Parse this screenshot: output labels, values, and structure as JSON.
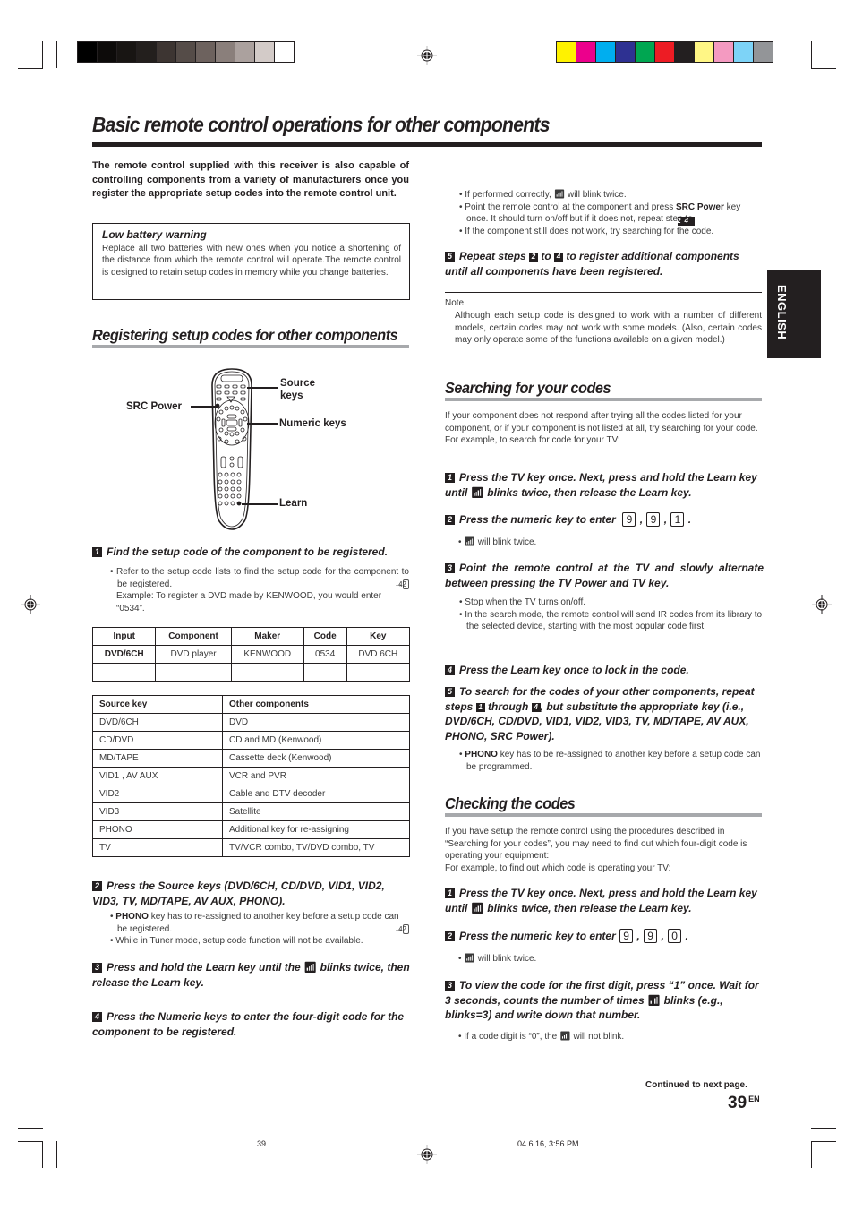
{
  "print_marks": {
    "gray_swatches": [
      "#000000",
      "#0d0b0a",
      "#181513",
      "#231f1d",
      "#3d3532",
      "#554c48",
      "#6d625e",
      "#8a7f7b",
      "#aba19e",
      "#d3cbc8",
      "#ffffff"
    ],
    "color_swatches": [
      "#fff200",
      "#ec008c",
      "#00aeef",
      "#2e3192",
      "#00a651",
      "#ed1c24",
      "#231f20",
      "#fff685",
      "#f49ac1",
      "#7dd3f7",
      "#939598"
    ],
    "footer_page": "39",
    "footer_timestamp": "04.6.16, 3:56 PM"
  },
  "page": {
    "title": "Basic remote control operations for other components",
    "language_tab": "ENGLISH",
    "continued": "Continued to next page.",
    "page_number": "39",
    "page_suffix": "EN"
  },
  "intro": "The remote control supplied with this receiver is also capable of controlling components from a variety of manufacturers once you register the appropriate setup codes into the remote control unit.",
  "warning": {
    "title": "Low battery warning",
    "body": "Replace all two batteries with new ones when you notice a shortening of the distance from which the remote control will operate.The remote control is designed to retain setup codes in memory while you change batteries."
  },
  "registering": {
    "title": "Registering setup codes for other components",
    "remote_labels": {
      "src_power": "SRC Power",
      "source_keys_1": "Source",
      "source_keys_2": "keys",
      "numeric_keys": "Numeric keys",
      "learn": "Learn"
    },
    "step1": {
      "num": "1",
      "text": "Find the setup code of the component to be registered.",
      "bullet_a": "Refer to the setup code lists to find the setup code for the component to be registered.",
      "ref": "42",
      "example": "Example: To register a DVD made by KENWOOD, you would enter “0534”."
    },
    "table1": {
      "headers": [
        "Input",
        "Component",
        "Maker",
        "Code",
        "Key"
      ],
      "rows": [
        [
          "DVD/6CH",
          "DVD player",
          "KENWOOD",
          "0534",
          "DVD 6CH"
        ],
        [
          "",
          "",
          "",
          "",
          ""
        ]
      ]
    },
    "table2": {
      "headers": [
        "Source key",
        "Other components"
      ],
      "rows": [
        [
          "DVD/6CH",
          "DVD"
        ],
        [
          "CD/DVD",
          "CD and MD (Kenwood)"
        ],
        [
          "MD/TAPE",
          "Cassette deck (Kenwood)"
        ],
        [
          "VID1 , AV AUX",
          "VCR and PVR"
        ],
        [
          "VID2",
          "Cable and DTV decoder"
        ],
        [
          "VID3",
          "Satellite"
        ],
        [
          "PHONO",
          "Additional key for re-assigning"
        ],
        [
          "TV",
          "TV/VCR combo, TV/DVD combo, TV"
        ]
      ]
    },
    "step2": {
      "num": "2",
      "text": "Press the Source keys (DVD/6CH, CD/DVD, VID1, VID2, VID3, TV, MD/TAPE, AV AUX, PHONO).",
      "bullet_a_bold": "PHONO",
      "bullet_a": " key has to re-assigned to another key before a setup code can be registered.",
      "ref": "42",
      "bullet_b": "While in Tuner mode, setup code function will not be available."
    },
    "step3": {
      "num": "3",
      "text_a": "Press and hold the Learn key until the ",
      "text_b": " blinks twice, then release the Learn key."
    },
    "step4": {
      "num": "4",
      "text": "Press the Numeric keys to enter the four-digit code for the component to be registered."
    },
    "right_bullets": {
      "a1": "If performed correctly, ",
      "a2": " will blink twice.",
      "b1": "Point the remote control at the component and press ",
      "b_bold": "SRC Power",
      "b2": " key once. It should turn on/off but if it does not, repeat step ",
      "b_from": "2",
      "b_to_word": " to ",
      "b_to": "4",
      "c": "If the component still does not work, try searching for the code."
    },
    "step5": {
      "num": "5",
      "t1": "Repeat steps ",
      "from": "2",
      "t2": " to ",
      "to": "4",
      "t3": " to register additional components until all components have been registered."
    },
    "note": {
      "label": "Note",
      "body": "Although each setup code is designed to work with a number of different models, certain codes may not work with some models. (Also, certain codes may only operate some of the functions available on a given model.)"
    }
  },
  "searching": {
    "title": "Searching for your codes",
    "intro": "If your component does not respond after trying all the codes listed for your component, or if your component is not listed at all, try searching for your code.",
    "example": "For example, to search for code for your TV:",
    "step1": {
      "num": "1",
      "a": "Press the TV key once. Next, press and hold the Learn  key until ",
      "b": " blinks twice, then release the Learn key."
    },
    "step2": {
      "num": "2",
      "text": "Press the numeric key to enter",
      "keys": [
        "9",
        "9",
        "1"
      ],
      "bullet": " will blink twice."
    },
    "step3": {
      "num": "3",
      "text": "Point the remote control at the TV and slowly alternate between pressing the TV Power and TV key.",
      "bullet_a": "Stop when the TV turns on/off.",
      "bullet_b": "In the search mode, the remote control will send IR codes from its library to the selected device, starting with the most popular code first."
    },
    "step4": {
      "num": "4",
      "text": "Press the Learn key once to lock in the code."
    },
    "step5": {
      "num": "5",
      "t1": "To search for the codes of your other components, repeat steps ",
      "from": "1",
      "t2": " through ",
      "to": "4",
      "t3": ", but substitute the appropriate key (i.e., DVD/6CH, CD/DVD, VID1, VID2, VID3, TV, MD/TAPE, AV AUX, PHONO, SRC Power).",
      "bullet_bold": "PHONO",
      "bullet": " key has to be re-assigned to another key before a setup code can be programmed."
    }
  },
  "checking": {
    "title": "Checking the codes",
    "intro": "If you have setup the remote control using the procedures described in “Searching for your codes”, you may need to find out which four-digit code is operating your equipment:",
    "example": "For example, to find out which code is operating your TV:",
    "step1": {
      "num": "1",
      "a": "Press the TV key once. Next, press and hold the Learn key until ",
      "b": " blinks twice, then release the Learn key."
    },
    "step2": {
      "num": "2",
      "text": "Press the numeric key to enter",
      "keys": [
        "9",
        "9",
        "0"
      ],
      "bullet": " will blink twice."
    },
    "step3": {
      "num": "3",
      "a": "To view the code for the first digit, press “1” once. Wait for 3 seconds, counts the number of times ",
      "b": " blinks (e.g., blinks=3) and write down that number.",
      "bullet_a": "If a code digit is “0”, the ",
      "bullet_b": " will not blink."
    }
  }
}
